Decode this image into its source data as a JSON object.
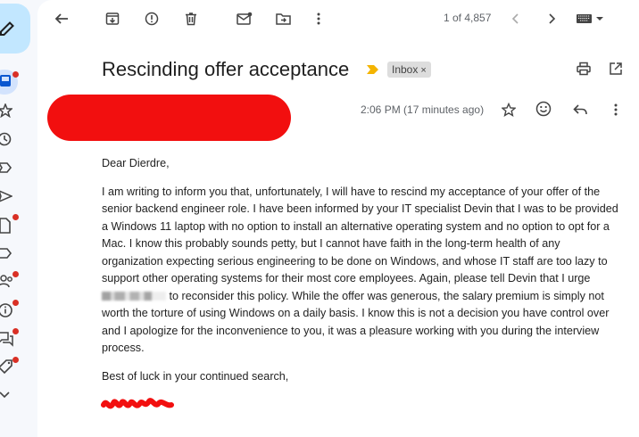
{
  "toolbar": {
    "counter": "1 of 4,857"
  },
  "message": {
    "subject": "Rescinding offer acceptance",
    "label_chip": "Inbox",
    "chip_close": "×",
    "timestamp": "2:06 PM (17 minutes ago)",
    "greeting": "Dear Dierdre,",
    "body_part1": "I am writing to inform you that, unfortunately, I will have to rescind my acceptance of your offer of the senior backend engineer role. I have been informed by your IT specialist Devin that I was to be provided a Windows 11 laptop with no option to install an alternative operating system and no option to opt for a Mac. I know this probably sounds petty, but I cannot have faith in the long-term health of any organization expecting serious engineering to be done on Windows, and whose IT staff are too lazy to support other operating systems for their most core employees. Again, please tell Devin that I urge",
    "body_part2": "to reconsider this policy. While the offer was generous, the salary premium is simply not worth the torture of using Windows on a daily basis. I know this is not a decision you have control over and I apologize for the inconvenience to you, it was a pleasure working with you during the interview process.",
    "closing": "Best of luck in your continued search,"
  },
  "colors": {
    "accent_blue": "#c2e7ff",
    "badge_red": "#d93025",
    "redaction_red": "#f20f0f",
    "importance_yellow": "#f4b400"
  },
  "icons": [
    "back-icon",
    "archive-icon",
    "report-spam-icon",
    "delete-icon",
    "mark-unread-icon",
    "move-to-icon",
    "more-vert-icon",
    "prev-icon",
    "next-icon",
    "keyboard-icon",
    "print-icon",
    "open-new-window-icon",
    "star-icon",
    "emoji-icon",
    "reply-icon"
  ]
}
